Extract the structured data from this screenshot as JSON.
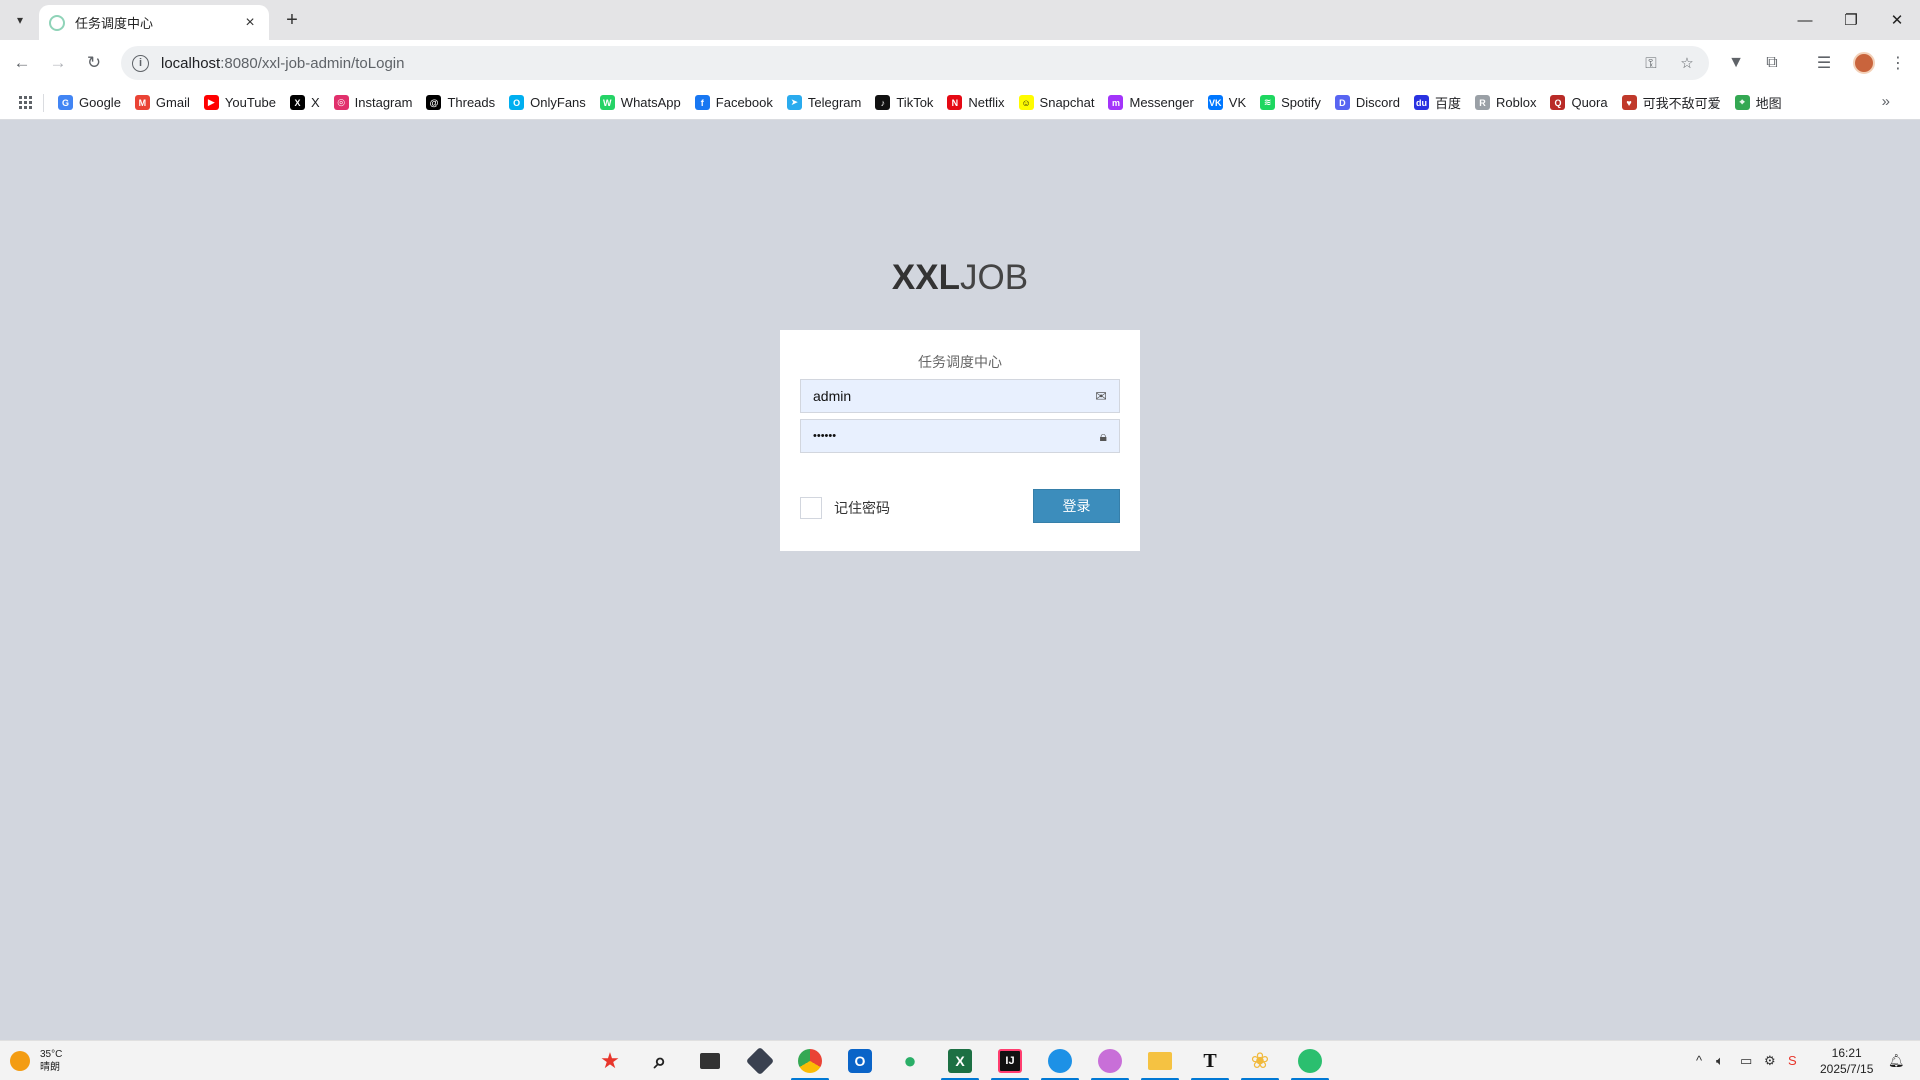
{
  "browser": {
    "tab_title": "任务调度中心",
    "url_host": "localhost",
    "url_rest": ":8080/xxl-job-admin/toLogin"
  },
  "bookmarks": [
    {
      "label": "Google",
      "icon": "google-icon",
      "color": "#4285f4",
      "glyph": "G"
    },
    {
      "label": "Gmail",
      "icon": "gmail-icon",
      "color": "#ea4335",
      "glyph": "M"
    },
    {
      "label": "YouTube",
      "icon": "youtube-icon",
      "color": "#ff0000",
      "glyph": "▶"
    },
    {
      "label": "X",
      "icon": "x-icon",
      "color": "#000000",
      "glyph": "X"
    },
    {
      "label": "Instagram",
      "icon": "instagram-icon",
      "color": "#e1306c",
      "glyph": "◎"
    },
    {
      "label": "Threads",
      "icon": "threads-icon",
      "color": "#000000",
      "glyph": "@"
    },
    {
      "label": "OnlyFans",
      "icon": "onlyfans-icon",
      "color": "#00aff0",
      "glyph": "O"
    },
    {
      "label": "WhatsApp",
      "icon": "whatsapp-icon",
      "color": "#25d366",
      "glyph": "W"
    },
    {
      "label": "Facebook",
      "icon": "facebook-icon",
      "color": "#1877f2",
      "glyph": "f"
    },
    {
      "label": "Telegram",
      "icon": "telegram-icon",
      "color": "#2aabee",
      "glyph": "➤"
    },
    {
      "label": "TikTok",
      "icon": "tiktok-icon",
      "color": "#111111",
      "glyph": "♪"
    },
    {
      "label": "Netflix",
      "icon": "netflix-icon",
      "color": "#e50914",
      "glyph": "N"
    },
    {
      "label": "Snapchat",
      "icon": "snapchat-icon",
      "color": "#fffc00",
      "glyph": "☺"
    },
    {
      "label": "Messenger",
      "icon": "messenger-icon",
      "color": "#a334fa",
      "glyph": "m"
    },
    {
      "label": "VK",
      "icon": "vk-icon",
      "color": "#0077ff",
      "glyph": "VK"
    },
    {
      "label": "Spotify",
      "icon": "spotify-icon",
      "color": "#1ed760",
      "glyph": "≋"
    },
    {
      "label": "Discord",
      "icon": "discord-icon",
      "color": "#5865f2",
      "glyph": "D"
    },
    {
      "label": "百度",
      "icon": "baidu-icon",
      "color": "#2932e1",
      "glyph": "du"
    },
    {
      "label": "Roblox",
      "icon": "roblox-icon",
      "color": "#9aa0a6",
      "glyph": "R"
    },
    {
      "label": "Quora",
      "icon": "quora-icon",
      "color": "#b92b27",
      "glyph": "Q"
    },
    {
      "label": "可我不敌可爱",
      "icon": "custom-bookmark-icon",
      "color": "#c0392b",
      "glyph": "♥"
    },
    {
      "label": "地图",
      "icon": "maps-icon",
      "color": "#34a853",
      "glyph": "⌖"
    }
  ],
  "login": {
    "logo_bold": "XXL",
    "logo_rest": "JOB",
    "message": "任务调度中心",
    "username": "admin",
    "password_mask": "••••••",
    "remember_label": "记住密码",
    "submit_label": "登录"
  },
  "taskbar": {
    "temperature": "35°C",
    "weather": "晴朗",
    "time": "16:21",
    "date": "2025/7/15"
  }
}
